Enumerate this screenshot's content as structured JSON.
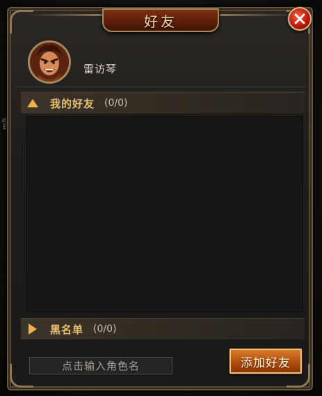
{
  "background": {
    "cropped_text": "雷"
  },
  "window": {
    "title": "好友",
    "close_icon": "close-x-icon"
  },
  "player": {
    "name": "雷访琴",
    "avatar_icon": "warrior-portrait-avatar"
  },
  "sections": {
    "friends": {
      "label": "我的好友",
      "count": "(0/0)",
      "arrow_icon": "triangle-up-icon"
    },
    "blacklist": {
      "label": "黑名单",
      "count": "(0/0)",
      "arrow_icon": "triangle-right-icon"
    }
  },
  "search": {
    "placeholder": "点击输入角色名",
    "value": ""
  },
  "actions": {
    "add_friend_label": "添加好友"
  },
  "colors": {
    "accent_gold": "#e8c070",
    "title_banner": "#6a240c",
    "button_orange": "#c45c18",
    "close_red": "#c8200e",
    "frame_bronze": "#8f7a55"
  }
}
